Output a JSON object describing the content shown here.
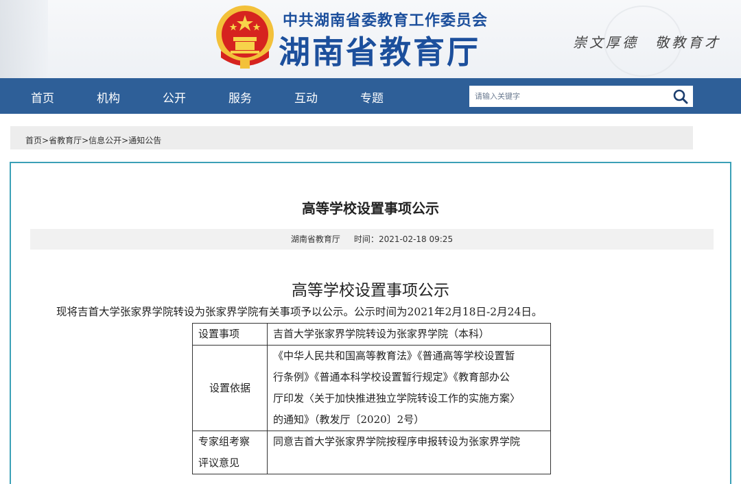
{
  "header": {
    "org_name": "中共湖南省委教育工作委员会",
    "site_name": "湖南省教育厅",
    "motto": "崇文厚德　敬教育才",
    "emblem_icon": "national-emblem-icon"
  },
  "nav": {
    "items": [
      "首页",
      "机构",
      "公开",
      "服务",
      "互动",
      "专题"
    ],
    "search_placeholder": "请输入关键字",
    "search_icon": "search-icon"
  },
  "breadcrumb": [
    "首页",
    "省教育厅",
    "信息公开",
    "通知公告"
  ],
  "article": {
    "title": "高等学校设置事项公示",
    "source": "湖南省教育厅",
    "time_label": "时间：",
    "time_value": "2021-02-18 09:25",
    "body_title": "高等学校设置事项公示",
    "intro": "现将吉首大学张家界学院转设为张家界学院有关事项予以公示。公示时间为2021年2月18日-2月24日。",
    "table": [
      {
        "key": "设置事项",
        "value": [
          "吉首大学张家界学院转设为张家界学院（本科）"
        ]
      },
      {
        "key": "设置依据",
        "value": [
          "《中华人民共和国高等教育法》《普通高等学校设置暂",
          "行条例》《普通本科学校设置暂行规定》《教育部办公",
          "厅印发〈关于加快推进独立学院转设工作的实施方案〉",
          "的通知》（教发厅〔2020〕2号）"
        ]
      },
      {
        "key_lines": [
          "专家组考察",
          "评议意见"
        ],
        "value": [
          "同意吉首大学张家界学院按程序申报转设为张家界学院"
        ]
      }
    ]
  },
  "colors": {
    "brand_blue": "#1c4f9c",
    "nav_bg": "#2e5f98",
    "content_border": "#3aa0b6"
  }
}
